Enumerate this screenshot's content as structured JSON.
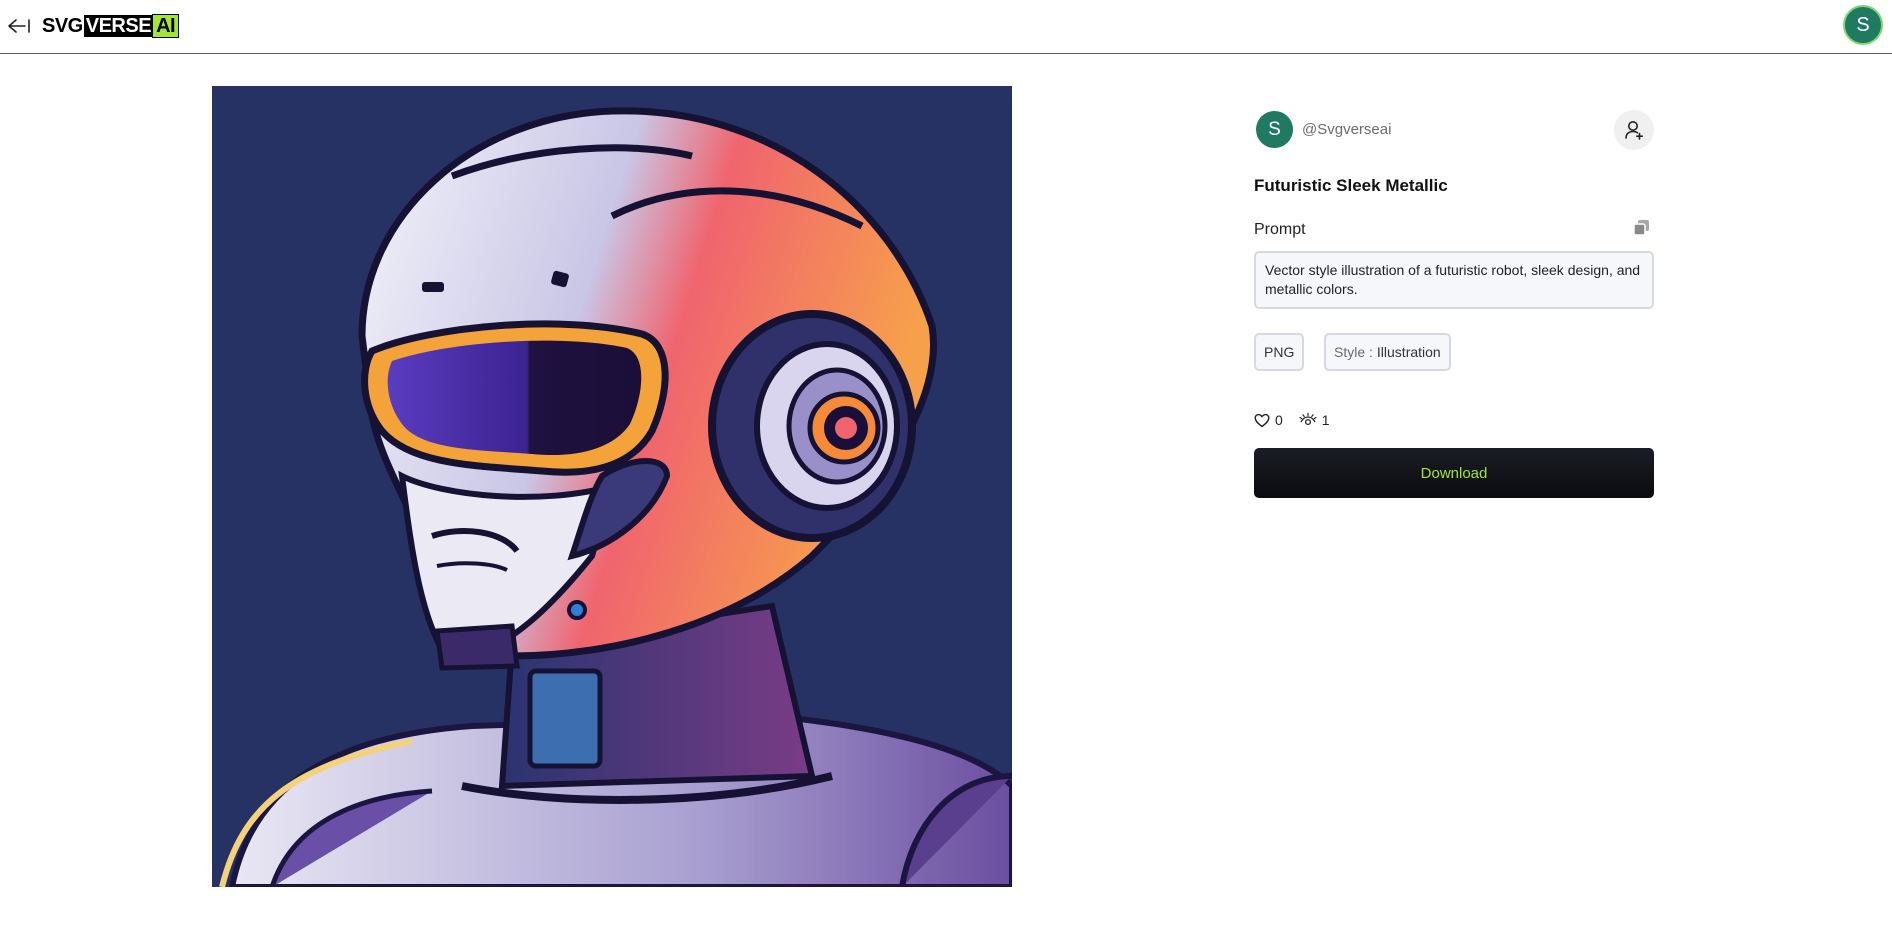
{
  "header": {
    "back_icon": "arrow-left-icon",
    "logo": {
      "part1": "SVG",
      "part2": "VERSE",
      "part3": "AI"
    },
    "user_avatar_letter": "S"
  },
  "artwork": {
    "subject": "robot-illustration",
    "background_color": "#263263"
  },
  "panel": {
    "author": {
      "avatar_letter": "S",
      "handle": "@Svgverseai"
    },
    "follow_icon": "user-plus-icon",
    "title": "Futuristic Sleek Metallic",
    "prompt_label": "Prompt",
    "copy_icon": "copy-icon",
    "prompt_text": "Vector style illustration of a futuristic robot, sleek design, and metallic colors.",
    "tags": {
      "format": "PNG",
      "style_prefix": "Style : ",
      "style_value": "Illustration"
    },
    "stats": {
      "likes": "0",
      "views": "1"
    },
    "download_label": "Download"
  },
  "colors": {
    "brand_green": "#a3e635",
    "avatar_bg": "#1f7a61"
  }
}
